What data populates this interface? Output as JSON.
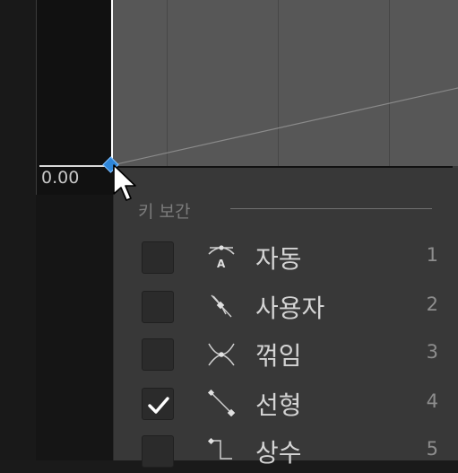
{
  "editor": {
    "value_label": "0.00"
  },
  "menu": {
    "section_title": "키 보간",
    "items": [
      {
        "label": "자동",
        "shortcut": "1",
        "checked": false,
        "icon": "auto-interp-icon"
      },
      {
        "label": "사용자",
        "shortcut": "2",
        "checked": false,
        "icon": "user-interp-icon"
      },
      {
        "label": "꺾임",
        "shortcut": "3",
        "checked": false,
        "icon": "break-interp-icon"
      },
      {
        "label": "선형",
        "shortcut": "4",
        "checked": true,
        "icon": "linear-interp-icon"
      },
      {
        "label": "상수",
        "shortcut": "5",
        "checked": false,
        "icon": "constant-interp-icon"
      }
    ]
  },
  "colors": {
    "key_selected": "#2e86d9",
    "graph_bg": "#575757",
    "menu_bg": "#383838"
  }
}
